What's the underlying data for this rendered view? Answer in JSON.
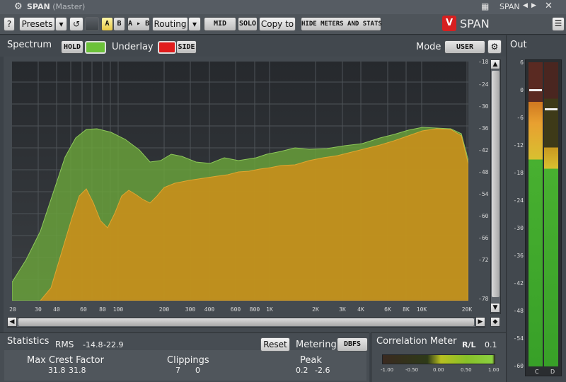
{
  "window": {
    "app": "SPAN",
    "sub": "(Master)",
    "right_title": "SPAN"
  },
  "toolbar": {
    "help": "?",
    "presets": "Presets",
    "dropdown": "▾",
    "undo": "↺",
    "ab_a": "A",
    "ab_b": "B",
    "ab_copy": "A ▸ B",
    "routing": "Routing",
    "mid": "MID",
    "solo": "SOLO",
    "copy_to": "Copy to",
    "hide": "HIDE METERS AND STATS",
    "logo": "SPAN"
  },
  "spectrum": {
    "title": "Spectrum",
    "hold": "HOLD",
    "underlay": "Underlay",
    "side": "SIDE",
    "mode_label": "Mode",
    "mode_value": "USER",
    "y_ticks": [
      "-18",
      "-24",
      "-30",
      "-36",
      "-42",
      "-48",
      "-54",
      "-60",
      "-66",
      "-72",
      "-78"
    ],
    "x_ticks": [
      "20",
      "30",
      "40",
      "60",
      "80",
      "100",
      "200",
      "300",
      "400",
      "600",
      "800",
      "1K",
      "2K",
      "3K",
      "4K",
      "6K",
      "8K",
      "10K",
      "20K"
    ]
  },
  "out": {
    "title": "Out",
    "ticks": [
      "6",
      "0",
      "-6",
      "-12",
      "-18",
      "-24",
      "-30",
      "-36",
      "-42",
      "-48",
      "-54",
      "-60"
    ],
    "ch1": "C",
    "ch2": "D"
  },
  "statistics": {
    "title": "Statistics",
    "rms_label": "RMS",
    "rms_1": "-14.8",
    "rms_2": "-22.9",
    "reset": "Reset",
    "metering_label": "Metering",
    "metering_value": "DBFS",
    "crest_label": "Max Crest Factor",
    "crest_1": "31.8",
    "crest_2": "31.8",
    "clip_label": "Clippings",
    "clip_1": "7",
    "clip_2": "0",
    "peak_label": "Peak",
    "peak_1": "0.2",
    "peak_2": "-2.6"
  },
  "correlation": {
    "title": "Correlation Meter",
    "rl_label": "R/L",
    "rl_value": "0.1",
    "ticks": [
      "-1.00",
      "-0.50",
      "0.00",
      "0.50",
      "1.00"
    ]
  },
  "colors": {
    "green": "#6aa43a",
    "orange": "#c98f1c",
    "accent_green": "#6cc23a",
    "red": "#e01c1c"
  }
}
